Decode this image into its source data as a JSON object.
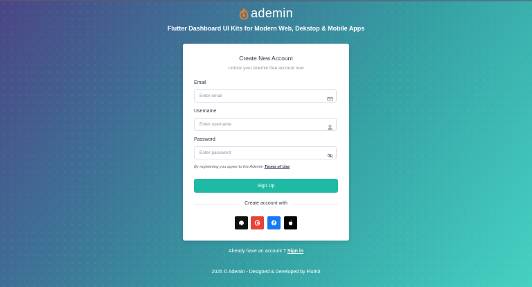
{
  "brand": {
    "name": "ademin",
    "accent": "#f47c20"
  },
  "subtitle": "Flutter Dashboard UI Kits for Modern Web, Dekstop & Mobile Apps",
  "card": {
    "title": "Create New Account",
    "subtitle": "Unlock your Ademin free account now",
    "email_label": "Email",
    "email_placeholder": "Enter email",
    "username_label": "Username",
    "username_placeholder": "Enter username",
    "password_label": "Password",
    "password_placeholder": "Enter password",
    "terms_prefix": "By registering you agree to the Ademin",
    "terms_link": "Terms of Use",
    "signup_label": "Sign Up",
    "divider_text": "Create account with",
    "social": [
      {
        "name": "github",
        "color": "#111111"
      },
      {
        "name": "google",
        "color": "#ea4335"
      },
      {
        "name": "facebook",
        "color": "#1877f2"
      },
      {
        "name": "apple",
        "color": "#000000"
      }
    ],
    "button_color": "#1fbaa4"
  },
  "footer": {
    "question": "Already have an account ?",
    "signin_label": "Sign in",
    "copyright": "2025 © Ademin - Designed & Developed by FlutKit"
  }
}
